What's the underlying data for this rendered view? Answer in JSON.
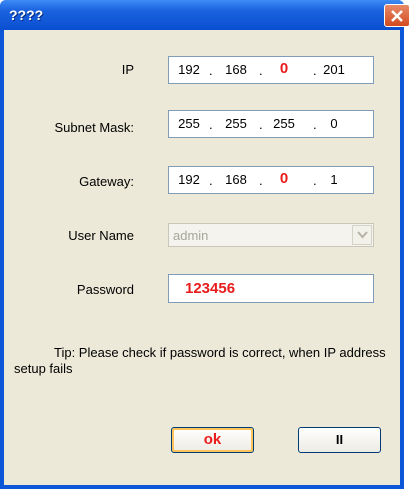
{
  "window": {
    "title": "????"
  },
  "ip": {
    "label": "IP",
    "octets": [
      "192",
      "168",
      "0",
      "201"
    ]
  },
  "subnet": {
    "label": "Subnet Mask:",
    "octets": [
      "255",
      "255",
      "255",
      "0"
    ]
  },
  "gateway": {
    "label": "Gateway:",
    "octets": [
      "192",
      "168",
      "0",
      "1"
    ]
  },
  "user": {
    "label": "User Name",
    "value": "admin"
  },
  "password": {
    "label": "Password",
    "value": "123456"
  },
  "tip": {
    "text": "Tip:  Please check if password is correct, when IP address setup fails"
  },
  "buttons": {
    "ok_label": "ok",
    "cancel_label": "II"
  },
  "colors": {
    "highlight": "#e81c1c",
    "title_bar": "#0a4fd0",
    "dialog_bg": "#ece9d8"
  }
}
